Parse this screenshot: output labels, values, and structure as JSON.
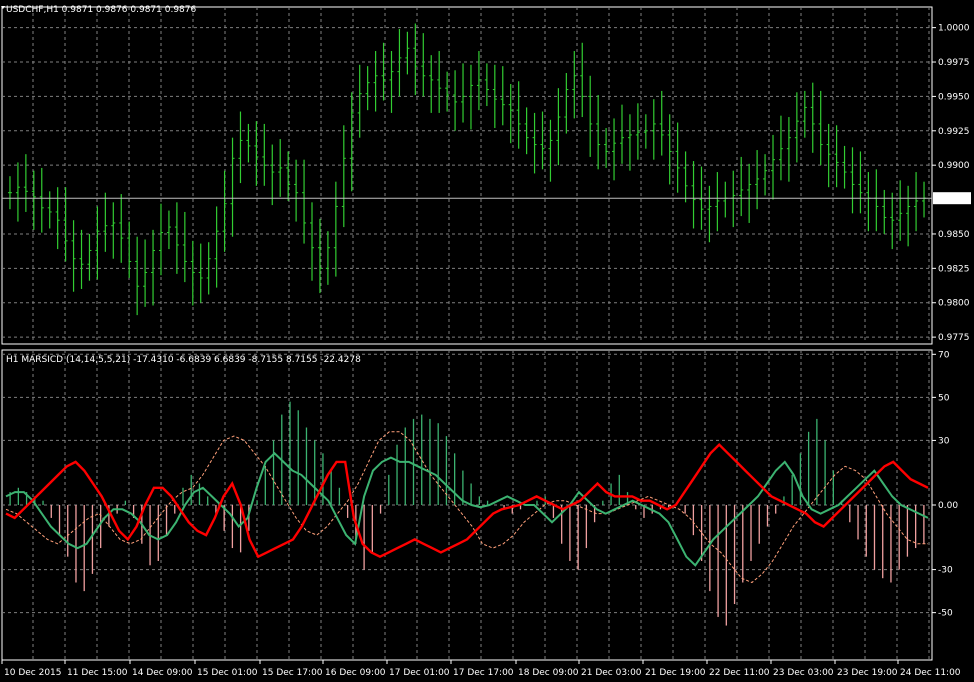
{
  "main_panel": {
    "header": "USDCHF,H1  0.9871 0.9876 0.9871 0.9876",
    "price_label": "0.9876",
    "price_line": 0.9876,
    "colors": {
      "bars": "#32cd32",
      "grid": "#7f7f7f",
      "price_line": "#c0c0c0",
      "price_box": "#ffffff"
    }
  },
  "indicator_panel": {
    "header": "H1 MARSICD (14,14,5,5,21) -17.4310 -6.6839 6.6839 -8.7155 8.7155 -22.4278",
    "colors": {
      "positive_hist": "#3cb371",
      "negative_hist": "#f0a0a0",
      "red_line": "#ff0000",
      "green_line": "#3cb371",
      "dashed": "#ffa07a"
    }
  },
  "x_axis": {
    "labels": [
      "10 Dec 2015",
      "11 Dec 15:00",
      "14 Dec 09:00",
      "15 Dec 01:00",
      "15 Dec 17:00",
      "16 Dec 09:00",
      "17 Dec 01:00",
      "17 Dec 17:00",
      "18 Dec 09:00",
      "21 Dec 03:00",
      "21 Dec 19:00",
      "22 Dec 11:00",
      "23 Dec 03:00",
      "23 Dec 19:00",
      "24 Dec 11:00"
    ]
  },
  "chart_data": [
    {
      "type": "line",
      "title": "USDCHF,H1",
      "description_series": "hourly bars",
      "ylim": [
        0.977,
        1.0015
      ],
      "y_ticks": [
        "1.0000",
        "0.9975",
        "0.9950",
        "0.9925",
        "0.9900",
        "0.9850",
        "0.9825",
        "0.9800",
        "0.9775"
      ],
      "y_tick_values": [
        1.0,
        0.9975,
        0.995,
        0.9925,
        0.99,
        0.985,
        0.9825,
        0.98,
        0.9775
      ],
      "close": [
        0.988,
        0.9884,
        0.9881,
        0.9877,
        0.9869,
        0.9866,
        0.986,
        0.9845,
        0.9832,
        0.9828,
        0.9838,
        0.9852,
        0.9856,
        0.9858,
        0.9847,
        0.983,
        0.9812,
        0.9822,
        0.9838,
        0.9851,
        0.9855,
        0.9842,
        0.983,
        0.9822,
        0.9818,
        0.9832,
        0.9852,
        0.9872,
        0.9905,
        0.9918,
        0.9914,
        0.9906,
        0.99,
        0.9895,
        0.9898,
        0.9886,
        0.988,
        0.9858,
        0.984,
        0.9825,
        0.984,
        0.987,
        0.9905,
        0.9938,
        0.9952,
        0.996,
        0.9965,
        0.9962,
        0.9968,
        0.9978,
        0.9985,
        0.9972,
        0.9965,
        0.9962,
        0.9956,
        0.9951,
        0.9946,
        0.995,
        0.9958,
        0.9962,
        0.9955,
        0.9948,
        0.9944,
        0.994,
        0.993,
        0.992,
        0.9915,
        0.9912,
        0.9918,
        0.9935,
        0.9955,
        0.9965,
        0.995,
        0.993,
        0.9915,
        0.991,
        0.9916,
        0.992,
        0.9922,
        0.9924,
        0.9925,
        0.993,
        0.9922,
        0.991,
        0.9898,
        0.9885,
        0.9875,
        0.9868,
        0.987,
        0.9874,
        0.9876,
        0.9878,
        0.9882,
        0.9886,
        0.989,
        0.9896,
        0.9904,
        0.9912,
        0.992,
        0.9932,
        0.9942,
        0.993,
        0.9915,
        0.9908,
        0.9902,
        0.9895,
        0.9886,
        0.988,
        0.9876,
        0.987,
        0.9862,
        0.986,
        0.9865,
        0.987,
        0.9874,
        0.9876
      ]
    },
    {
      "type": "bar",
      "title": "H1 MARSICD (14,14,5,5,21)",
      "ylim": [
        -72,
        72
      ],
      "y_ticks": [
        "70",
        "50",
        "30",
        "0.00",
        "-30",
        "-50"
      ],
      "y_tick_values": [
        70,
        50,
        30,
        0,
        -30,
        -50
      ],
      "values": [
        -17.431,
        -6.6839,
        6.6839,
        -8.7155,
        8.7155,
        -22.4278
      ],
      "histogram": [
        6,
        8,
        6,
        4,
        2,
        -6,
        -14,
        -24,
        -36,
        -40,
        -32,
        -20,
        -10,
        -4,
        2,
        -6,
        -18,
        -28,
        -26,
        -14,
        -4,
        8,
        14,
        10,
        4,
        -4,
        -12,
        -20,
        -22,
        -12,
        2,
        18,
        30,
        42,
        48,
        44,
        36,
        30,
        24,
        16,
        8,
        -6,
        -18,
        -30,
        -22,
        -4,
        14,
        28,
        36,
        40,
        42,
        40,
        38,
        32,
        24,
        16,
        10,
        4,
        2,
        0,
        -2,
        -4,
        -2,
        0,
        2,
        4,
        -6,
        -18,
        -26,
        -30,
        -20,
        -8,
        2,
        10,
        14,
        6,
        -2,
        -6,
        -4,
        -2,
        -1,
        0,
        -4,
        -14,
        -26,
        -40,
        -52,
        -56,
        -46,
        -36,
        -26,
        -18,
        -10,
        -4,
        4,
        14,
        24,
        34,
        40,
        30,
        16,
        2,
        -8,
        -16,
        -24,
        -30,
        -34,
        -36,
        -30,
        -24,
        -20,
        -18
      ],
      "red_line": [
        -4,
        -6,
        -2,
        2,
        6,
        10,
        14,
        18,
        20,
        16,
        10,
        4,
        -4,
        -12,
        -16,
        -10,
        0,
        8,
        8,
        4,
        -2,
        -8,
        -12,
        -14,
        -6,
        4,
        10,
        0,
        -16,
        -24,
        -22,
        -20,
        -18,
        -16,
        -10,
        -2,
        6,
        14,
        20,
        20,
        -6,
        -18,
        -22,
        -24,
        -22,
        -20,
        -18,
        -16,
        -18,
        -20,
        -22,
        -20,
        -18,
        -16,
        -12,
        -8,
        -4,
        -2,
        -1,
        0,
        2,
        4,
        2,
        0,
        -2,
        0,
        2,
        6,
        10,
        6,
        4,
        4,
        4,
        2,
        2,
        0,
        -2,
        0,
        6,
        12,
        18,
        24,
        28,
        24,
        20,
        16,
        12,
        8,
        4,
        2,
        0,
        -2,
        -4,
        -8,
        -10,
        -6,
        -2,
        2,
        6,
        10,
        14,
        18,
        20,
        16,
        12,
        10,
        8
      ],
      "green_line": [
        4,
        6,
        6,
        2,
        -4,
        -10,
        -14,
        -18,
        -20,
        -18,
        -12,
        -6,
        -2,
        -2,
        -4,
        -8,
        -14,
        -16,
        -14,
        -8,
        0,
        6,
        8,
        4,
        0,
        -4,
        -10,
        -6,
        8,
        20,
        24,
        20,
        16,
        14,
        10,
        6,
        2,
        -6,
        -14,
        -18,
        4,
        16,
        20,
        22,
        20,
        20,
        18,
        16,
        14,
        10,
        6,
        2,
        0,
        -1,
        0,
        2,
        4,
        2,
        0,
        0,
        -4,
        -8,
        -4,
        0,
        6,
        2,
        -2,
        -4,
        -2,
        0,
        2,
        0,
        -2,
        -4,
        -8,
        -16,
        -24,
        -28,
        -22,
        -16,
        -12,
        -8,
        -4,
        0,
        4,
        10,
        16,
        20,
        14,
        4,
        -2,
        -4,
        -2,
        0,
        4,
        8,
        12,
        16,
        10,
        4,
        0,
        -2,
        -4,
        -6
      ],
      "dashed_line": [
        -2,
        -4,
        -8,
        -12,
        -16,
        -18,
        -14,
        -10,
        -6,
        -4,
        -10,
        -16,
        -18,
        -16,
        -10,
        -4,
        2,
        6,
        8,
        14,
        22,
        30,
        32,
        30,
        24,
        18,
        10,
        2,
        -6,
        -12,
        -14,
        -10,
        -4,
        2,
        10,
        20,
        30,
        34,
        34,
        30,
        22,
        14,
        8,
        2,
        -4,
        -10,
        -18,
        -20,
        -18,
        -14,
        -8,
        -4,
        0,
        2,
        2,
        0,
        -2,
        -4,
        -4,
        -2,
        0,
        2,
        4,
        2,
        0,
        -2,
        -6,
        -12,
        -18,
        -22,
        -28,
        -34,
        -36,
        -32,
        -26,
        -18,
        -10,
        -4,
        2,
        8,
        14,
        18,
        16,
        12,
        4,
        -4,
        -10,
        -16,
        -18,
        -18
      ]
    }
  ]
}
